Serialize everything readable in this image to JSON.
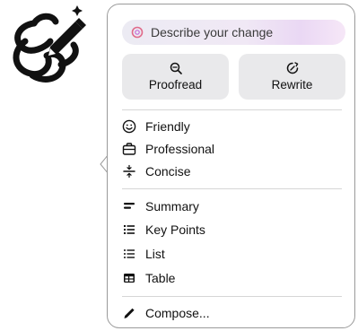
{
  "logo": {
    "icon": "writing-tools-logo-icon"
  },
  "panel": {
    "describe": {
      "placeholder": "Describe your change",
      "icon": "sparkle-icon"
    },
    "actions": [
      {
        "label": "Proofread",
        "icon": "magnifier-check-icon"
      },
      {
        "label": "Rewrite",
        "icon": "rewrite-circle-icon"
      }
    ],
    "tone_items": [
      {
        "label": "Friendly",
        "icon": "smiley-icon"
      },
      {
        "label": "Professional",
        "icon": "briefcase-icon"
      },
      {
        "label": "Concise",
        "icon": "divide-icon"
      }
    ],
    "format_items": [
      {
        "label": "Summary",
        "icon": "summary-lines-icon"
      },
      {
        "label": "Key Points",
        "icon": "bullet-list-icon"
      },
      {
        "label": "List",
        "icon": "list-icon"
      },
      {
        "label": "Table",
        "icon": "table-icon"
      }
    ],
    "compose_item": {
      "label": "Compose...",
      "icon": "pencil-icon"
    }
  },
  "colors": {
    "button_bg": "#e9e9eb",
    "border": "#9a9a9a",
    "divider": "#d6d6d6",
    "sparkle_accent": "#e06a8a"
  }
}
